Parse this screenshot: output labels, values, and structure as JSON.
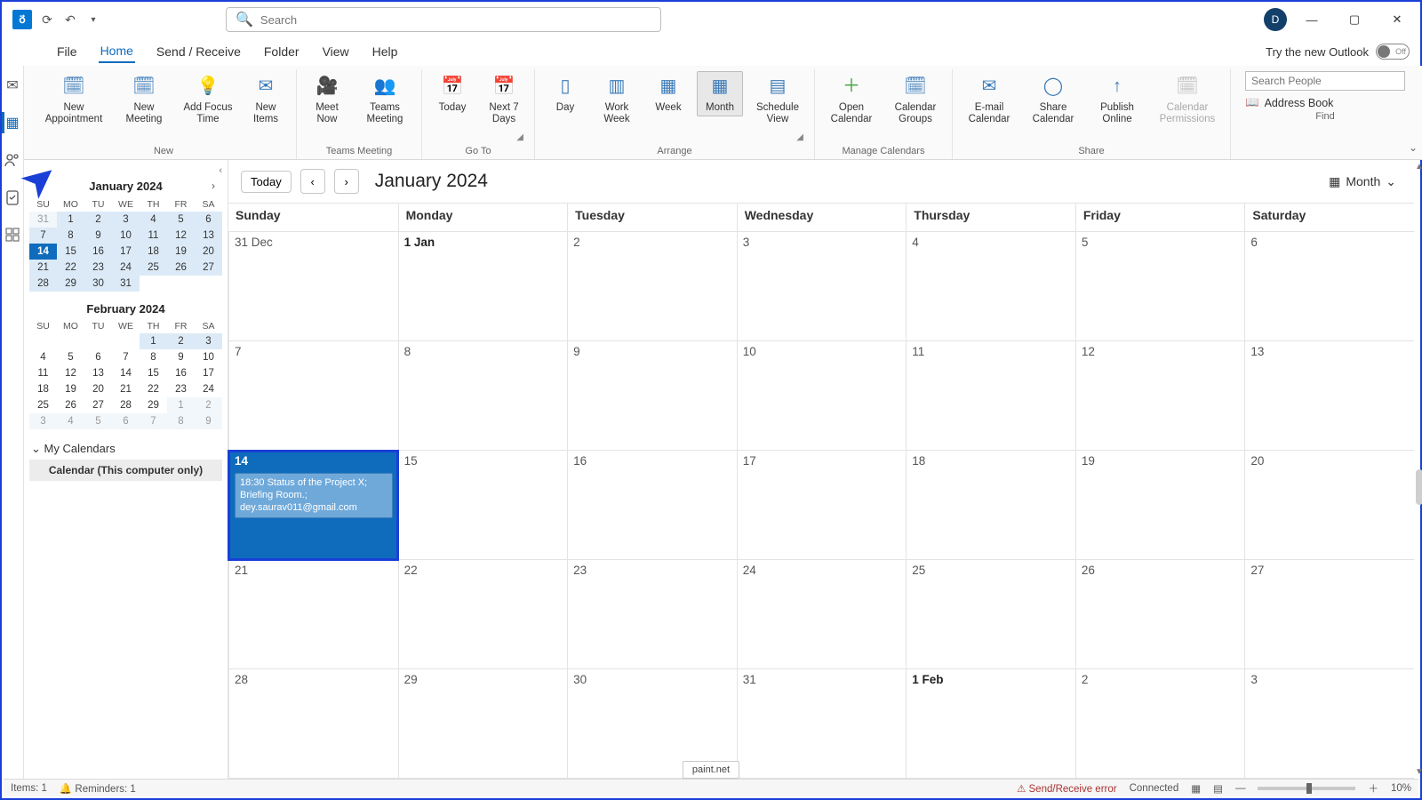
{
  "search": {
    "placeholder": "Search"
  },
  "titlebar": {
    "avatar_initial": "D"
  },
  "try_new": {
    "label": "Try the new Outlook",
    "toggle_state": "Off"
  },
  "menu": {
    "file": "File",
    "home": "Home",
    "sendreceive": "Send / Receive",
    "folder": "Folder",
    "view": "View",
    "help": "Help"
  },
  "ribbon": {
    "groups": {
      "new": {
        "label": "New",
        "new_appt": "New Appointment",
        "new_meeting": "New Meeting",
        "focus": "Add Focus Time",
        "new_items": "New Items"
      },
      "teams": {
        "label": "Teams Meeting",
        "meet_now": "Meet Now",
        "teams_meeting": "Teams Meeting"
      },
      "goto": {
        "label": "Go To",
        "today": "Today",
        "next7": "Next 7 Days"
      },
      "arrange": {
        "label": "Arrange",
        "day": "Day",
        "workweek": "Work Week",
        "week": "Week",
        "month": "Month",
        "schedule": "Schedule View"
      },
      "manage": {
        "label": "Manage Calendars",
        "open": "Open Calendar",
        "groups": "Calendar Groups"
      },
      "share": {
        "label": "Share",
        "email": "E-mail Calendar",
        "share": "Share Calendar",
        "publish": "Publish Online",
        "perm": "Calendar Permissions"
      },
      "find": {
        "label": "Find",
        "search_placeholder": "Search People",
        "address_book": "Address Book"
      }
    }
  },
  "nav": {
    "month1": {
      "title": "January 2024",
      "dows": [
        "SU",
        "MO",
        "TU",
        "WE",
        "TH",
        "FR",
        "SA"
      ],
      "rows": [
        [
          {
            "n": "31",
            "cls": "dim"
          },
          {
            "n": "1",
            "cls": "hl"
          },
          {
            "n": "2",
            "cls": "hl"
          },
          {
            "n": "3",
            "cls": "hl"
          },
          {
            "n": "4",
            "cls": "hl"
          },
          {
            "n": "5",
            "cls": "hl"
          },
          {
            "n": "6",
            "cls": "hl"
          }
        ],
        [
          {
            "n": "7",
            "cls": "hl"
          },
          {
            "n": "8",
            "cls": "hl"
          },
          {
            "n": "9",
            "cls": "hl"
          },
          {
            "n": "10",
            "cls": "hl"
          },
          {
            "n": "11",
            "cls": "hl"
          },
          {
            "n": "12",
            "cls": "hl"
          },
          {
            "n": "13",
            "cls": "hl"
          }
        ],
        [
          {
            "n": "14",
            "cls": "today"
          },
          {
            "n": "15",
            "cls": "hl"
          },
          {
            "n": "16",
            "cls": "hl"
          },
          {
            "n": "17",
            "cls": "hl"
          },
          {
            "n": "18",
            "cls": "hl"
          },
          {
            "n": "19",
            "cls": "hl"
          },
          {
            "n": "20",
            "cls": "hl"
          }
        ],
        [
          {
            "n": "21",
            "cls": "hl"
          },
          {
            "n": "22",
            "cls": "hl"
          },
          {
            "n": "23",
            "cls": "hl"
          },
          {
            "n": "24",
            "cls": "hl"
          },
          {
            "n": "25",
            "cls": "hl"
          },
          {
            "n": "26",
            "cls": "hl"
          },
          {
            "n": "27",
            "cls": "hl"
          }
        ],
        [
          {
            "n": "28",
            "cls": "hl"
          },
          {
            "n": "29",
            "cls": "hl"
          },
          {
            "n": "30",
            "cls": "hl"
          },
          {
            "n": "31",
            "cls": "hl"
          },
          {
            "n": "",
            "cls": ""
          },
          {
            "n": "",
            "cls": ""
          },
          {
            "n": "",
            "cls": ""
          }
        ]
      ]
    },
    "month2": {
      "title": "February 2024",
      "dows": [
        "SU",
        "MO",
        "TU",
        "WE",
        "TH",
        "FR",
        "SA"
      ],
      "rows": [
        [
          {
            "n": "",
            "cls": ""
          },
          {
            "n": "",
            "cls": ""
          },
          {
            "n": "",
            "cls": ""
          },
          {
            "n": "",
            "cls": ""
          },
          {
            "n": "1",
            "cls": "hl"
          },
          {
            "n": "2",
            "cls": "hl"
          },
          {
            "n": "3",
            "cls": "hl"
          }
        ],
        [
          {
            "n": "4",
            "cls": ""
          },
          {
            "n": "5",
            "cls": ""
          },
          {
            "n": "6",
            "cls": ""
          },
          {
            "n": "7",
            "cls": ""
          },
          {
            "n": "8",
            "cls": ""
          },
          {
            "n": "9",
            "cls": ""
          },
          {
            "n": "10",
            "cls": ""
          }
        ],
        [
          {
            "n": "11",
            "cls": ""
          },
          {
            "n": "12",
            "cls": ""
          },
          {
            "n": "13",
            "cls": ""
          },
          {
            "n": "14",
            "cls": ""
          },
          {
            "n": "15",
            "cls": ""
          },
          {
            "n": "16",
            "cls": ""
          },
          {
            "n": "17",
            "cls": ""
          }
        ],
        [
          {
            "n": "18",
            "cls": ""
          },
          {
            "n": "19",
            "cls": ""
          },
          {
            "n": "20",
            "cls": ""
          },
          {
            "n": "21",
            "cls": ""
          },
          {
            "n": "22",
            "cls": ""
          },
          {
            "n": "23",
            "cls": ""
          },
          {
            "n": "24",
            "cls": ""
          }
        ],
        [
          {
            "n": "25",
            "cls": ""
          },
          {
            "n": "26",
            "cls": ""
          },
          {
            "n": "27",
            "cls": ""
          },
          {
            "n": "28",
            "cls": ""
          },
          {
            "n": "29",
            "cls": ""
          },
          {
            "n": "1",
            "cls": "dim"
          },
          {
            "n": "2",
            "cls": "dim"
          }
        ],
        [
          {
            "n": "3",
            "cls": "dim"
          },
          {
            "n": "4",
            "cls": "dim"
          },
          {
            "n": "5",
            "cls": "dim"
          },
          {
            "n": "6",
            "cls": "dim"
          },
          {
            "n": "7",
            "cls": "dim"
          },
          {
            "n": "8",
            "cls": "dim"
          },
          {
            "n": "9",
            "cls": "dim"
          }
        ]
      ]
    },
    "mycal_header": "My Calendars",
    "mycal_item": "Calendar (This computer only)"
  },
  "calendar": {
    "today_btn": "Today",
    "title": "January 2024",
    "view_label": "Month",
    "dows": [
      "Sunday",
      "Monday",
      "Tuesday",
      "Wednesday",
      "Thursday",
      "Friday",
      "Saturday"
    ],
    "weeks": [
      [
        {
          "n": "31 Dec"
        },
        {
          "n": "1 Jan",
          "bold": true
        },
        {
          "n": "2"
        },
        {
          "n": "3"
        },
        {
          "n": "4"
        },
        {
          "n": "5"
        },
        {
          "n": "6"
        }
      ],
      [
        {
          "n": "7"
        },
        {
          "n": "8"
        },
        {
          "n": "9"
        },
        {
          "n": "10"
        },
        {
          "n": "11"
        },
        {
          "n": "12"
        },
        {
          "n": "13"
        }
      ],
      [
        {
          "n": "14",
          "selected": true,
          "event": "18:30 Status of the Project X; Briefing Room.; dey.saurav011@gmail.com"
        },
        {
          "n": "15"
        },
        {
          "n": "16"
        },
        {
          "n": "17"
        },
        {
          "n": "18"
        },
        {
          "n": "19"
        },
        {
          "n": "20"
        }
      ],
      [
        {
          "n": "21"
        },
        {
          "n": "22"
        },
        {
          "n": "23"
        },
        {
          "n": "24"
        },
        {
          "n": "25"
        },
        {
          "n": "26"
        },
        {
          "n": "27"
        }
      ],
      [
        {
          "n": "28"
        },
        {
          "n": "29"
        },
        {
          "n": "30"
        },
        {
          "n": "31"
        },
        {
          "n": "1 Feb",
          "bold": true
        },
        {
          "n": "2"
        },
        {
          "n": "3"
        }
      ]
    ]
  },
  "status": {
    "items": "Items: 1",
    "reminders": "Reminders: 1",
    "tooltip": "paint.net",
    "error": "Send/Receive error",
    "connected": "Connected",
    "zoom": "10%"
  }
}
